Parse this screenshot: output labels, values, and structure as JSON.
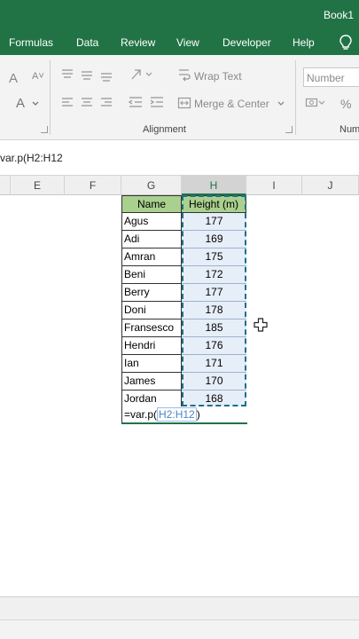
{
  "window": {
    "title": "Book1"
  },
  "menu": {
    "tabs": [
      "Formulas",
      "Data",
      "Review",
      "View",
      "Developer",
      "Help"
    ]
  },
  "ribbon": {
    "wrap_text": "Wrap Text",
    "merge_center": "Merge & Center",
    "alignment_group": "Alignment",
    "number_format": "Number",
    "number_group": "Num",
    "font_size_up": "A",
    "font_color": "A",
    "percent": "%"
  },
  "formula_bar": {
    "text": "var.p(H2:H12"
  },
  "columns": [
    "E",
    "F",
    "G",
    "H",
    "I",
    "J"
  ],
  "table": {
    "headers": {
      "name": "Name",
      "height": "Height (m)"
    },
    "rows": [
      {
        "name": "Agus",
        "height": "177"
      },
      {
        "name": "Adi",
        "height": "169"
      },
      {
        "name": "Amran",
        "height": "175"
      },
      {
        "name": "Beni",
        "height": "172"
      },
      {
        "name": "Berry",
        "height": "177"
      },
      {
        "name": "Doni",
        "height": "178"
      },
      {
        "name": "Fransesco",
        "height": "185"
      },
      {
        "name": "Hendri",
        "height": "176"
      },
      {
        "name": "Ian",
        "height": "171"
      },
      {
        "name": "James",
        "height": "170"
      },
      {
        "name": "Jordan",
        "height": "168"
      }
    ]
  },
  "active_cell": {
    "func": "=var.p(",
    "ref": "H2:H12",
    "close": ")"
  },
  "colors": {
    "excel_green": "#217346",
    "header_fill": "#a9d08e",
    "range_ref": "#4a86c5"
  },
  "icons": {
    "tell_me": "lightbulb-icon",
    "cursor": "plus-cursor-icon"
  }
}
